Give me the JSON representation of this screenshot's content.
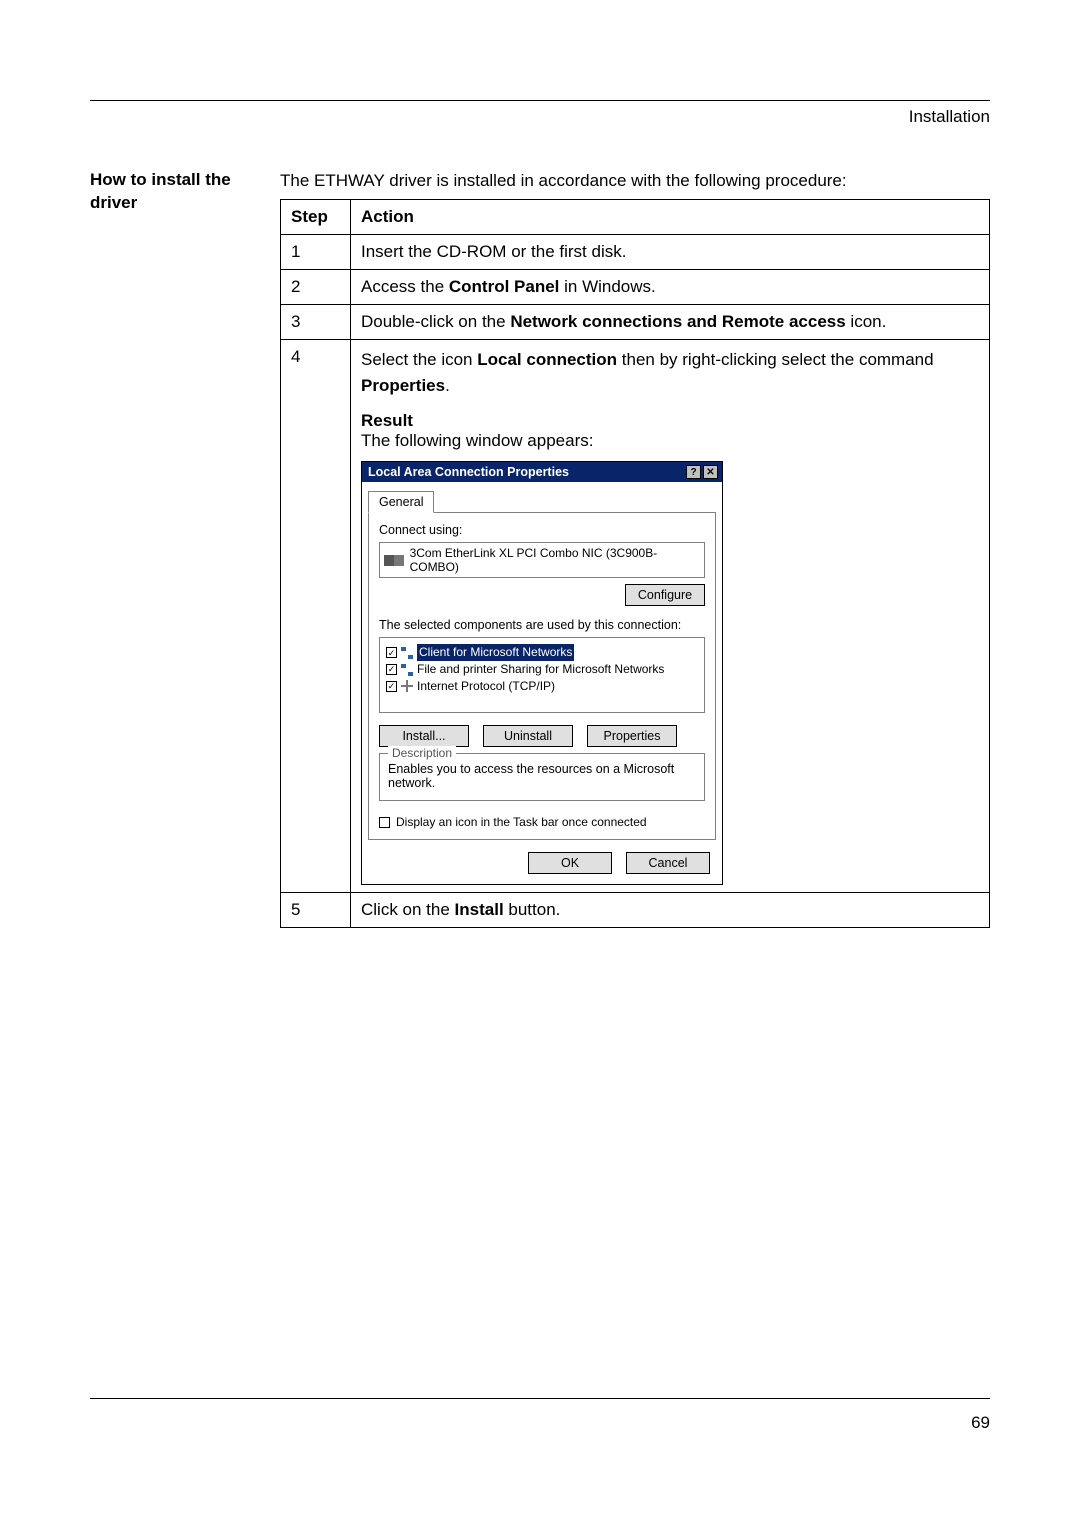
{
  "header": {
    "section": "Installation"
  },
  "side_heading": "How to install the driver",
  "intro": "The ETHWAY driver is installed in accordance with the following procedure:",
  "table": {
    "head": {
      "step": "Step",
      "action": "Action"
    },
    "rows": {
      "r1": {
        "num": "1",
        "text": "Insert the CD-ROM or the first disk."
      },
      "r2": {
        "num": "2",
        "prefix": "Access the ",
        "bold": "Control Panel",
        "suffix": " in Windows."
      },
      "r3": {
        "num": "3",
        "prefix": "Double-click on the ",
        "bold": "Network connections and Remote access",
        "suffix": " icon."
      },
      "r4": {
        "num": "4",
        "line1_prefix": "Select the icon ",
        "line1_bold": "Local connection",
        "line1_suffix": " then by right-clicking select the command ",
        "line2_bold": "Properties",
        "line2_suffix": ".",
        "result_label": "Result",
        "result_text": "The following window appears:"
      },
      "r5": {
        "num": "5",
        "prefix": "Click on the ",
        "bold": "Install",
        "suffix": " button."
      }
    }
  },
  "dialog": {
    "title": "Local Area Connection Properties",
    "help_glyph": "?",
    "close_glyph": "✕",
    "tab": "General",
    "connect_using": "Connect using:",
    "adapter": "3Com EtherLink XL PCI Combo NIC (3C900B-COMBO)",
    "configure": "Configure",
    "components_label": "The selected components are used by this connection:",
    "items": {
      "i1": "Client for Microsoft Networks",
      "i2": "File and printer Sharing for Microsoft Networks",
      "i3": "Internet Protocol (TCP/IP)"
    },
    "install": "Install...",
    "uninstall": "Uninstall",
    "properties": "Properties",
    "desc_legend": "Description",
    "desc_text": "Enables you to access the resources on a Microsoft network.",
    "taskbar": "Display an icon in the Task bar once connected",
    "ok": "OK",
    "cancel": "Cancel",
    "check_glyph": "✓"
  },
  "page_number": "69"
}
